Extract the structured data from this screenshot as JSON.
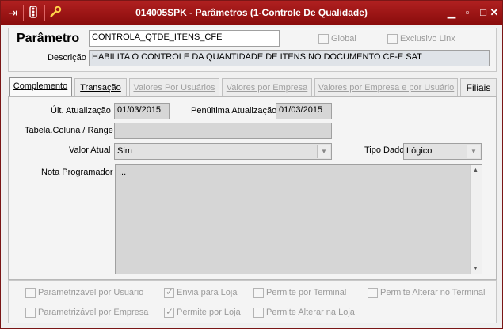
{
  "window": {
    "title": "014005SPK - Parâmetros (1-Controle De Qualidade)",
    "toolbar_icons": [
      "exit-icon",
      "traffic-light-icon",
      "wrench-icon"
    ],
    "controls": [
      "minimize-icon",
      "restore-icon",
      "maximize-icon",
      "close-icon"
    ]
  },
  "header": {
    "parametro_label": "Parâmetro",
    "parametro_value": "CONTROLA_QTDE_ITENS_CFE",
    "global_label": "Global",
    "global_checked": false,
    "exclusivo_label": "Exclusivo Linx",
    "exclusivo_checked": false,
    "descricao_label": "Descrição",
    "descricao_value": "HABILITA O CONTROLE DA QUANTIDADE DE ITENS NO DOCUMENTO CF-E SAT"
  },
  "tabs": [
    {
      "label": "Complemento",
      "active": true
    },
    {
      "label": "Transação",
      "active": false
    },
    {
      "label": "Valores Por Usuários",
      "active": false
    },
    {
      "label": "Valores por Empresa",
      "active": false
    },
    {
      "label": "Valores por Empresa e por Usuário",
      "active": false
    },
    {
      "label": "Filiais",
      "active": false
    }
  ],
  "complemento": {
    "ult_atualizacao_label": "Últ. Atualização",
    "ult_atualizacao_value": "01/03/2015",
    "penultima_label": "Penúltima Atualização",
    "penultima_value": "01/03/2015",
    "tabela_label": "Tabela.Coluna / Range",
    "tabela_value": "",
    "valor_atual_label": "Valor Atual",
    "valor_atual_value": "Sim",
    "tipo_dado_label": "Tipo Dado",
    "tipo_dado_value": "Lógico",
    "nota_label": "Nota Programador",
    "nota_value": "..."
  },
  "options": [
    {
      "label": "Parametrizável por Usuário",
      "checked": false
    },
    {
      "label": "Envia para Loja",
      "checked": true
    },
    {
      "label": "Permite por Terminal",
      "checked": false
    },
    {
      "label": "Permite Alterar no Terminal",
      "checked": false
    },
    {
      "label": "Parametrizável por Empresa",
      "checked": false
    },
    {
      "label": "Permite por Loja",
      "checked": true
    },
    {
      "label": "Permite Alterar na Loja",
      "checked": false
    }
  ],
  "colors": {
    "titlebar": "#9a1414",
    "accent_text": "#000000",
    "disabled_text": "#9a9a9a"
  }
}
